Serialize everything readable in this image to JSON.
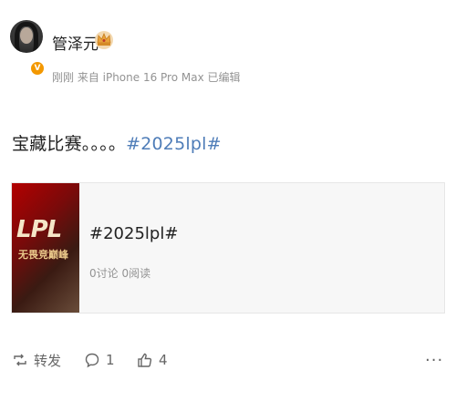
{
  "post": {
    "author": "管泽元",
    "crown_icon": "crown-icon",
    "verified_badge": "V",
    "meta": "刚刚 来自 iPhone 16 Pro Max 已编辑",
    "text": "宝藏比赛。。。。",
    "hashtag": "#2025lpl#"
  },
  "card": {
    "thumb_logo": "LPL",
    "thumb_sub": "无畏竞巅峰",
    "title": "#2025lpl#",
    "meta": "0讨论 0阅读"
  },
  "actions": {
    "repost_label": "转发",
    "comment_count": "1",
    "like_count": "4",
    "more": "···"
  },
  "colors": {
    "hashtag": "#4f7db8",
    "secondary_text": "#939393",
    "badge": "#f39800"
  }
}
